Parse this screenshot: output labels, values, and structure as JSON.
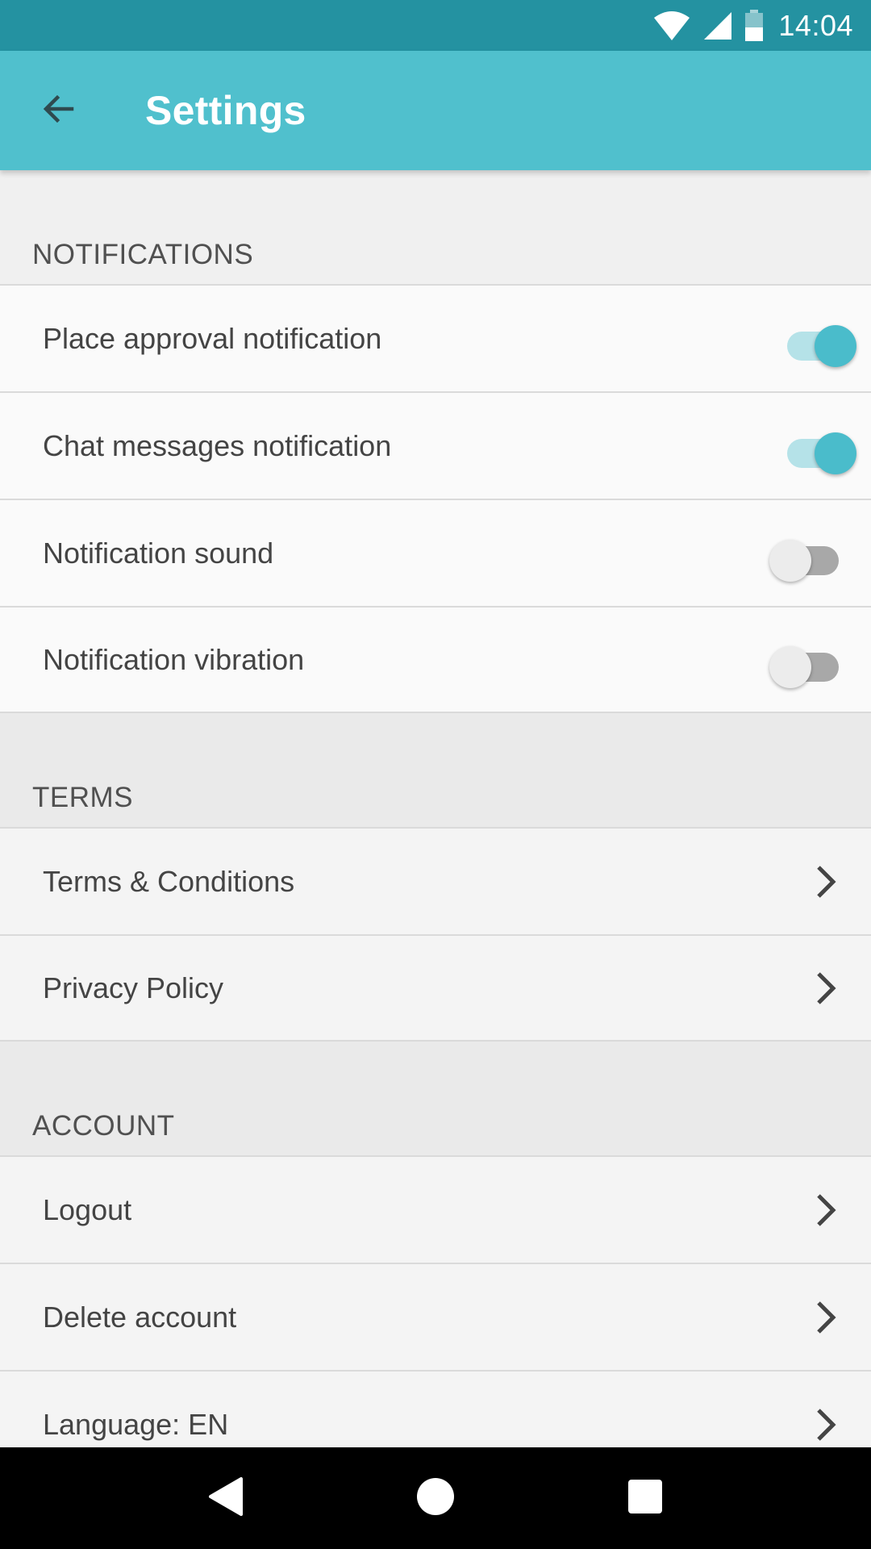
{
  "status_bar": {
    "time": "14:04",
    "icons": [
      "wifi-icon",
      "cell-signal-icon",
      "battery-icon"
    ]
  },
  "app_bar": {
    "back_icon": "arrow-back-icon",
    "title": "Settings"
  },
  "colors": {
    "status_bar": "#2492a1",
    "app_bar": "#50c0cd",
    "switch_on": "#4abccb",
    "switch_off_track": "#a8a8a8"
  },
  "sections": {
    "notifications": {
      "header": "NOTIFICATIONS",
      "items": [
        {
          "label": "Place approval notification",
          "enabled": true
        },
        {
          "label": "Chat messages notification",
          "enabled": true
        },
        {
          "label": "Notification sound",
          "enabled": false
        },
        {
          "label": "Notification vibration",
          "enabled": false
        }
      ]
    },
    "terms": {
      "header": "TERMS",
      "items": [
        {
          "label": "Terms & Conditions",
          "icon": "chevron-right-icon"
        },
        {
          "label": "Privacy Policy",
          "icon": "chevron-right-icon"
        }
      ]
    },
    "account": {
      "header": "ACCOUNT",
      "items": [
        {
          "label": "Logout",
          "icon": "chevron-right-icon"
        },
        {
          "label": "Delete account",
          "icon": "chevron-right-icon"
        },
        {
          "label": "Language: EN",
          "icon": "chevron-right-icon"
        }
      ]
    }
  },
  "nav_bar": {
    "buttons": [
      "back-triangle-icon",
      "home-circle-icon",
      "recents-square-icon"
    ]
  }
}
